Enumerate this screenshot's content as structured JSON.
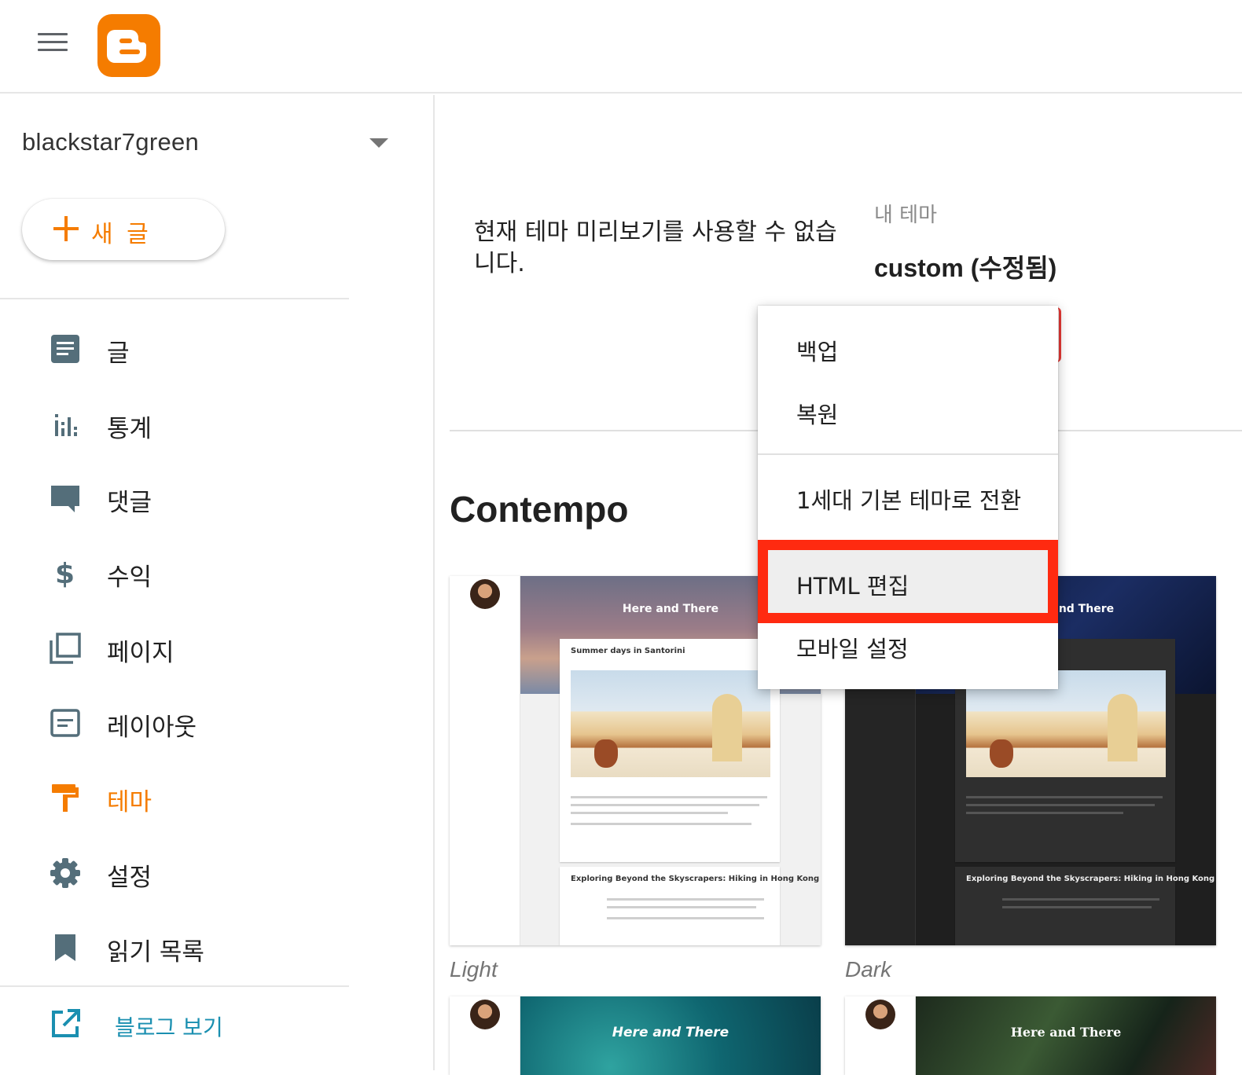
{
  "header": {
    "menu_icon": "hamburger-menu-icon",
    "logo": "blogger-logo"
  },
  "sidebar": {
    "blog_name": "blackstar7green",
    "new_post_label": "새 글",
    "items": [
      {
        "label": "글",
        "icon": "posts-icon"
      },
      {
        "label": "통계",
        "icon": "stats-icon"
      },
      {
        "label": "댓글",
        "icon": "comments-icon"
      },
      {
        "label": "수익",
        "icon": "dollar-icon"
      },
      {
        "label": "페이지",
        "icon": "pages-icon"
      },
      {
        "label": "레이아웃",
        "icon": "layout-icon"
      },
      {
        "label": "테마",
        "icon": "theme-paint-roller-icon",
        "active": true
      },
      {
        "label": "설정",
        "icon": "gear-icon"
      },
      {
        "label": "읽기 목록",
        "icon": "bookmark-icon"
      }
    ],
    "view_blog_label": "블로그 보기",
    "colors": {
      "accent": "#f57c00",
      "link": "#1a8fb0"
    }
  },
  "main": {
    "preview_message": "현재 테마 미리보기를 사용할 수 없습니다.",
    "my_theme_label": "내 테마",
    "my_theme_name": "custom (수정됨)",
    "section_title": "Contempo",
    "themes": [
      {
        "caption": "Light",
        "hero_title": "Here and There",
        "post_title": "Summer days in Santorini",
        "post2_title": "Exploring Beyond the Skyscrapers: Hiking in Hong Kong"
      },
      {
        "caption": "Dark",
        "hero_title": "Here and There",
        "post_title": "",
        "post2_title": "Exploring Beyond the Skyscrapers: Hiking in Hong Kong"
      },
      {
        "caption": "",
        "hero_title": "Here and There"
      },
      {
        "caption": "",
        "hero_title": "Here and There"
      }
    ]
  },
  "menu": {
    "items": [
      {
        "label": "백업"
      },
      {
        "label": "복원"
      },
      {
        "label": "1세대 기본 테마로 전환"
      },
      {
        "label": "HTML 편집",
        "highlighted": true
      },
      {
        "label": "모바일 설정"
      }
    ],
    "highlight_color": "#ff2a10"
  }
}
